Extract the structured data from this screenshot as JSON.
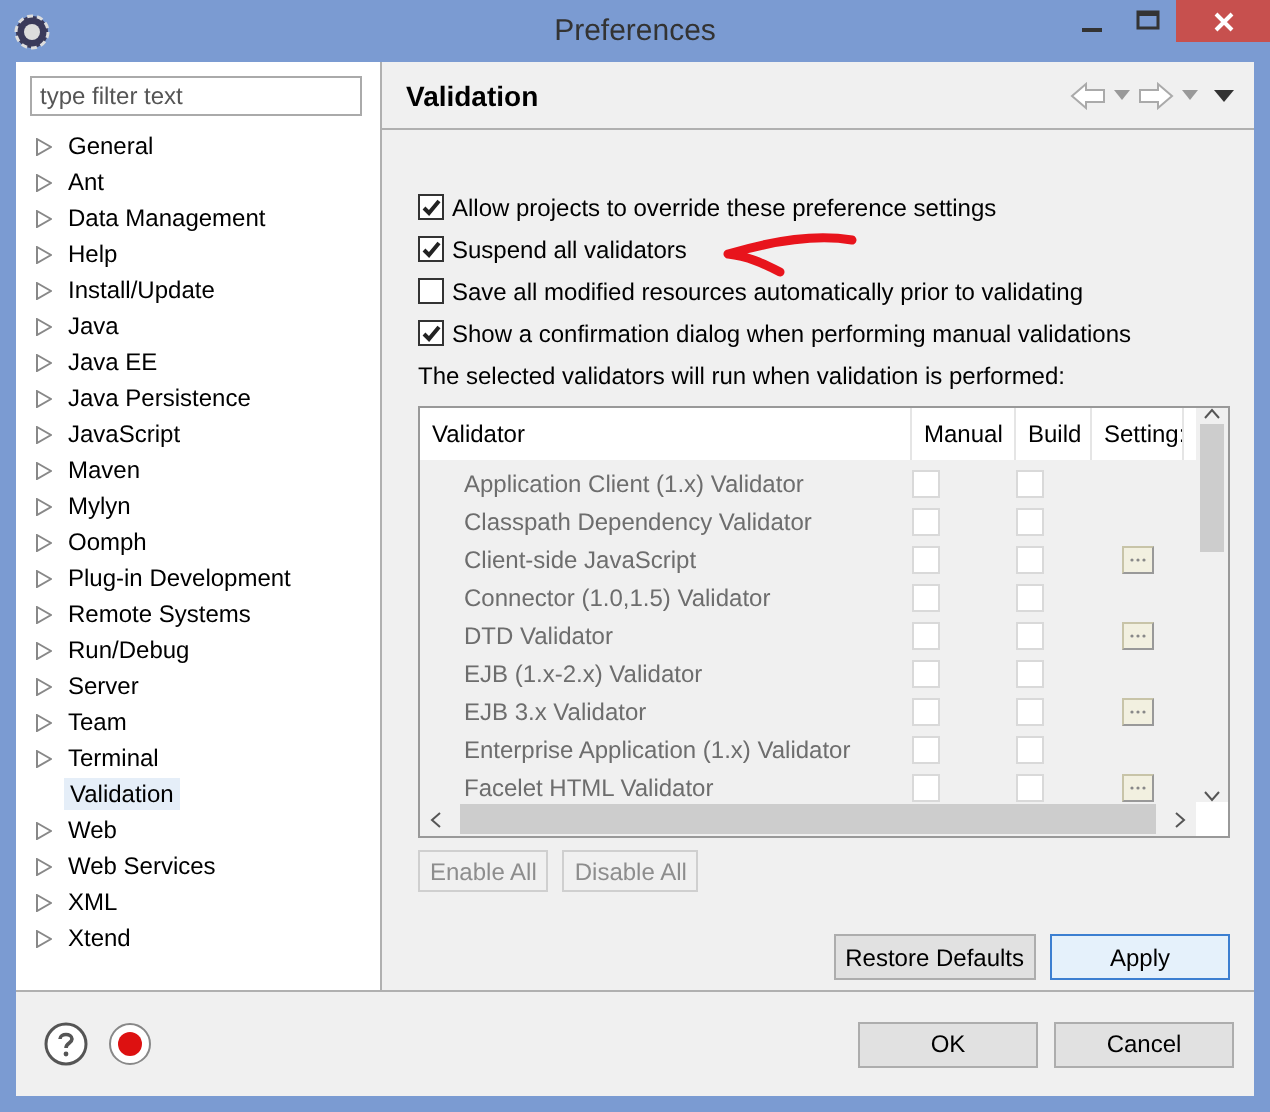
{
  "window": {
    "title": "Preferences"
  },
  "filter": {
    "placeholder": "type filter text"
  },
  "tree": [
    {
      "label": "General",
      "expandable": true,
      "selected": false
    },
    {
      "label": "Ant",
      "expandable": true,
      "selected": false
    },
    {
      "label": "Data Management",
      "expandable": true,
      "selected": false
    },
    {
      "label": "Help",
      "expandable": true,
      "selected": false
    },
    {
      "label": "Install/Update",
      "expandable": true,
      "selected": false
    },
    {
      "label": "Java",
      "expandable": true,
      "selected": false
    },
    {
      "label": "Java EE",
      "expandable": true,
      "selected": false
    },
    {
      "label": "Java Persistence",
      "expandable": true,
      "selected": false
    },
    {
      "label": "JavaScript",
      "expandable": true,
      "selected": false
    },
    {
      "label": "Maven",
      "expandable": true,
      "selected": false
    },
    {
      "label": "Mylyn",
      "expandable": true,
      "selected": false
    },
    {
      "label": "Oomph",
      "expandable": true,
      "selected": false
    },
    {
      "label": "Plug-in Development",
      "expandable": true,
      "selected": false
    },
    {
      "label": "Remote Systems",
      "expandable": true,
      "selected": false
    },
    {
      "label": "Run/Debug",
      "expandable": true,
      "selected": false
    },
    {
      "label": "Server",
      "expandable": true,
      "selected": false
    },
    {
      "label": "Team",
      "expandable": true,
      "selected": false
    },
    {
      "label": "Terminal",
      "expandable": true,
      "selected": false
    },
    {
      "label": "Validation",
      "expandable": false,
      "selected": true
    },
    {
      "label": "Web",
      "expandable": true,
      "selected": false
    },
    {
      "label": "Web Services",
      "expandable": true,
      "selected": false
    },
    {
      "label": "XML",
      "expandable": true,
      "selected": false
    },
    {
      "label": "Xtend",
      "expandable": true,
      "selected": false
    }
  ],
  "page": {
    "title": "Validation"
  },
  "options": [
    {
      "label": "Allow projects to override these preference settings",
      "checked": true
    },
    {
      "label": "Suspend all validators",
      "checked": true
    },
    {
      "label": "Save all modified resources automatically prior to validating",
      "checked": false
    },
    {
      "label": "Show a confirmation dialog when performing manual validations",
      "checked": true
    }
  ],
  "table_caption": "The selected validators will run when validation is performed:",
  "table": {
    "disabled": true,
    "columns": [
      "Validator",
      "Manual",
      "Build",
      "Setting:"
    ],
    "rows": [
      {
        "name": "Application Client (1.x) Validator",
        "manual": false,
        "build": false,
        "settings": false
      },
      {
        "name": "Classpath Dependency Validator",
        "manual": false,
        "build": false,
        "settings": false
      },
      {
        "name": "Client-side JavaScript",
        "manual": false,
        "build": false,
        "settings": true
      },
      {
        "name": "Connector (1.0,1.5) Validator",
        "manual": false,
        "build": false,
        "settings": false
      },
      {
        "name": "DTD Validator",
        "manual": false,
        "build": false,
        "settings": true
      },
      {
        "name": "EJB (1.x-2.x) Validator",
        "manual": false,
        "build": false,
        "settings": false
      },
      {
        "name": "EJB 3.x Validator",
        "manual": false,
        "build": false,
        "settings": true
      },
      {
        "name": "Enterprise Application (1.x) Validator",
        "manual": false,
        "build": false,
        "settings": false
      },
      {
        "name": "Facelet HTML Validator",
        "manual": false,
        "build": false,
        "settings": true
      }
    ]
  },
  "table_buttons": [
    {
      "label": "Enable All",
      "disabled": true
    },
    {
      "label": "Disable All",
      "disabled": true
    }
  ],
  "page_buttons": [
    {
      "label": "Restore Defaults",
      "default": false
    },
    {
      "label": "Apply",
      "default": true
    }
  ],
  "dialog_buttons": [
    {
      "label": "OK"
    },
    {
      "label": "Cancel"
    }
  ]
}
